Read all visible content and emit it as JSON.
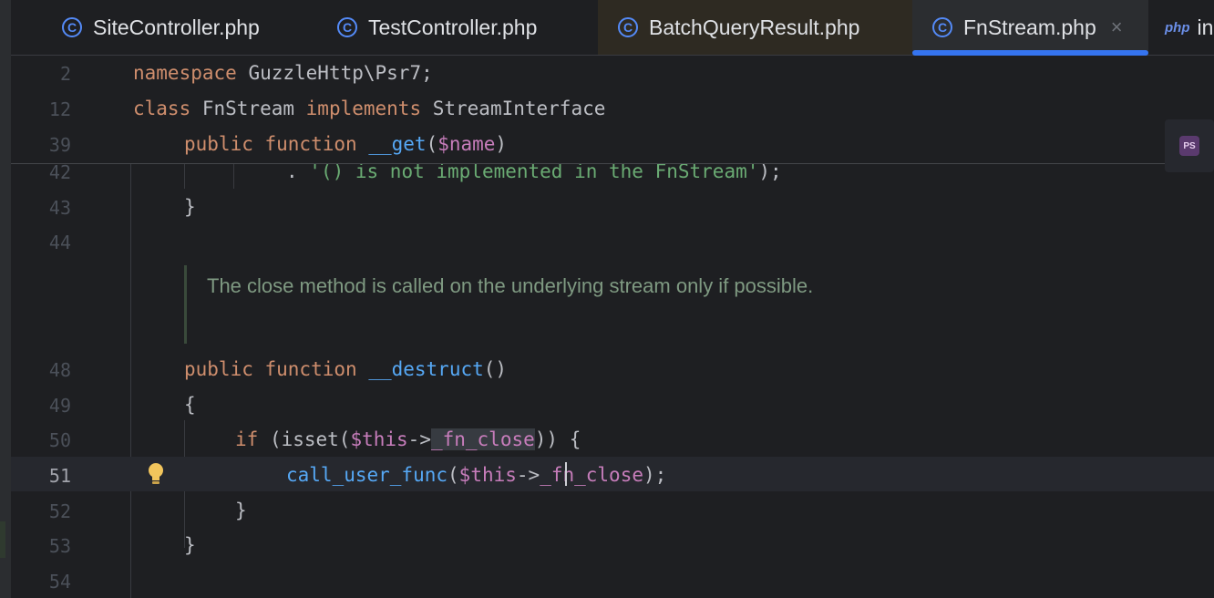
{
  "tabs": [
    {
      "label": "SiteController.php",
      "icon": "php-class-icon"
    },
    {
      "label": "TestController.php",
      "icon": "php-class-icon"
    },
    {
      "label": "BatchQueryResult.php",
      "icon": "php-class-icon"
    },
    {
      "label": "FnStream.php",
      "icon": "php-class-icon",
      "active": true,
      "close": "×"
    },
    {
      "label": "in",
      "icon_text": "php"
    }
  ],
  "sticky": {
    "lines": [
      {
        "num": "2",
        "code": [
          "namespace",
          " GuzzleHttp\\Psr7;"
        ]
      },
      {
        "num": "12",
        "code": [
          "class",
          " FnStream ",
          "implements",
          " StreamInterface"
        ]
      },
      {
        "num": "39",
        "code": [
          "public function",
          " ",
          "__get",
          "(",
          "$name",
          ")"
        ]
      }
    ]
  },
  "code": {
    "l42": {
      "num": "42",
      "text_a": ". ",
      "text_str": "'() is not implemented in the FnStream'",
      "text_b": ");"
    },
    "l43": {
      "num": "43",
      "text": "}"
    },
    "l44": {
      "num": "44"
    },
    "doc": "The close method is called on the underlying stream only if possible.",
    "l48": {
      "num": "48",
      "kw": "public function",
      "fn": "__destruct",
      "rest": "()"
    },
    "l49": {
      "num": "49",
      "text": "{"
    },
    "l50": {
      "num": "50",
      "kw": "if",
      "a": " (isset(",
      "var": "$this",
      "arrow": "->",
      "fld": "_fn_close",
      "b": ")) {"
    },
    "l51": {
      "num": "51",
      "fn": "call_user_func",
      "a": "(",
      "var": "$this",
      "arrow": "->",
      "fld": "_fn_close",
      "b": ");"
    },
    "l52": {
      "num": "52",
      "text": "}"
    },
    "l53": {
      "num": "53",
      "text": "}"
    },
    "l54": {
      "num": "54"
    }
  },
  "ps_badge": "PS"
}
